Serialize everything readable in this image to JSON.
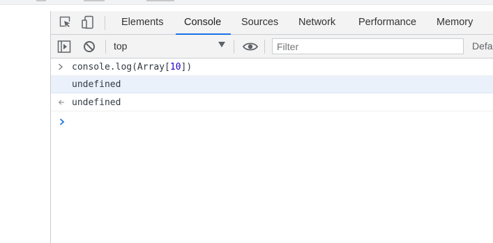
{
  "devtools": {
    "tabs": [
      {
        "label": "Elements"
      },
      {
        "label": "Console",
        "active": true
      },
      {
        "label": "Sources"
      },
      {
        "label": "Network"
      },
      {
        "label": "Performance"
      },
      {
        "label": "Memory"
      }
    ],
    "icons": {
      "inspect": "inspect-element-icon",
      "device": "device-toolbar-icon"
    }
  },
  "toolbar": {
    "context": "top",
    "filter_placeholder": "Filter",
    "levels_label": "Defa"
  },
  "console": {
    "rows": [
      {
        "kind": "input",
        "code_prefix": "console.log(Array[",
        "code_number": "10",
        "code_suffix": "])"
      },
      {
        "kind": "log",
        "text": "undefined"
      },
      {
        "kind": "result",
        "text": "undefined"
      }
    ]
  },
  "colors": {
    "accent": "#1a73e8",
    "highlight": "#eaf1fb",
    "number": "#1c00cf"
  }
}
